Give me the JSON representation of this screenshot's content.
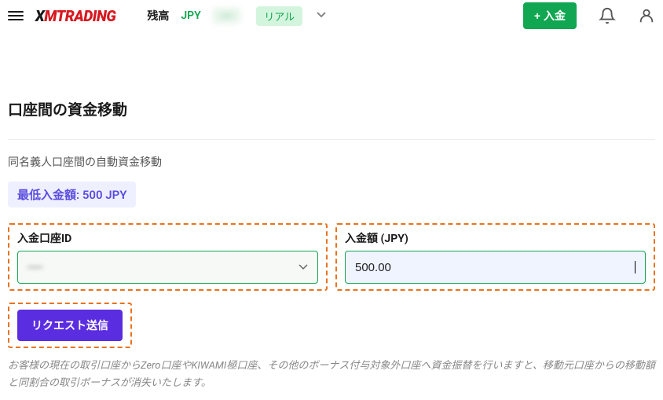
{
  "header": {
    "logo_prefix": "X",
    "logo_rest": "MTRADING",
    "balance_label": "残高",
    "currency": "JPY",
    "balance_amount": "----",
    "real_badge": "リアル",
    "deposit_btn": "+ 入金"
  },
  "page": {
    "title": "口座間の資金移動",
    "subtitle": "同名義人口座間の自動資金移動",
    "min_label": "最低入金額: 500 JPY",
    "note": "お客様の現在の取引口座からZero口座やKIWAMI極口座、その他のボーナス付与対象外口座へ資金振替を行いますと、移動元口座からの移動額と同割合の取引ボーナスが消失いたします。"
  },
  "form": {
    "account_label": "入金口座ID",
    "account_value": "-----",
    "amount_label": "入金額 (JPY)",
    "amount_value": "500.00",
    "submit_label": "リクエスト送信"
  }
}
